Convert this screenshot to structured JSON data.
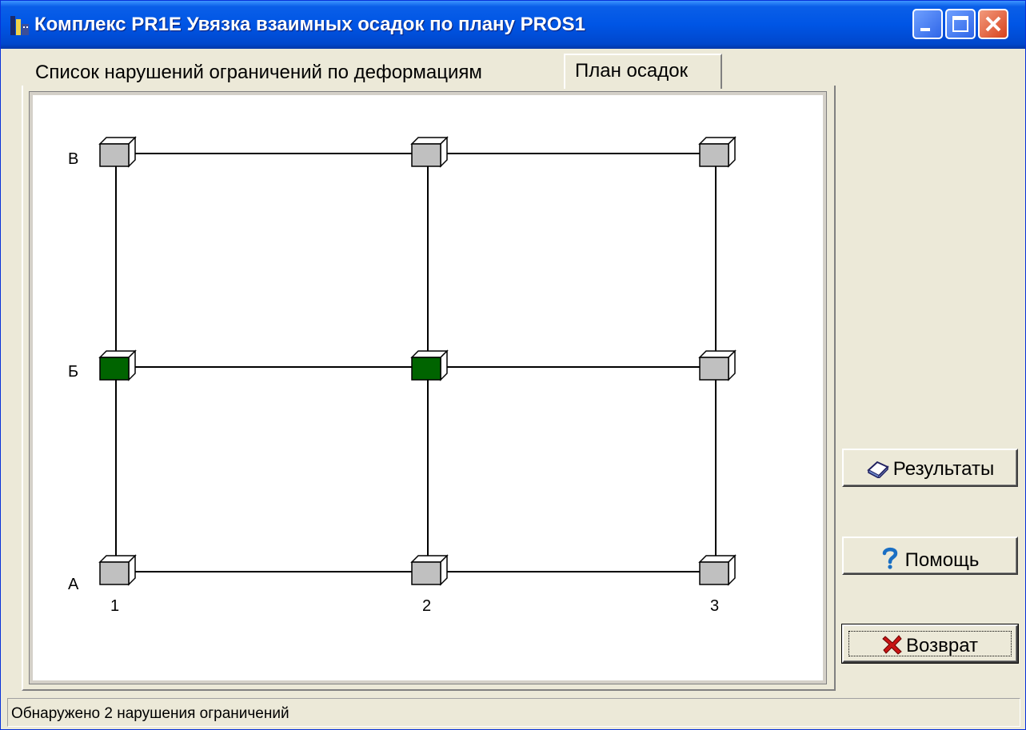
{
  "window": {
    "title": "Комплекс PR1E  Увязка взаимных осадок по плану PROS1"
  },
  "tabs": [
    {
      "label": "Список нарушений ограничений по деформациям",
      "active": false
    },
    {
      "label": "План осадок",
      "active": true
    }
  ],
  "plan": {
    "row_labels": [
      "В",
      "Б",
      "А"
    ],
    "column_labels": [
      "1",
      "2",
      "3"
    ],
    "nodes": [
      {
        "row": "В",
        "col": "1",
        "status": "normal"
      },
      {
        "row": "В",
        "col": "2",
        "status": "normal"
      },
      {
        "row": "В",
        "col": "3",
        "status": "normal"
      },
      {
        "row": "Б",
        "col": "1",
        "status": "violation"
      },
      {
        "row": "Б",
        "col": "2",
        "status": "violation"
      },
      {
        "row": "Б",
        "col": "3",
        "status": "normal"
      },
      {
        "row": "А",
        "col": "1",
        "status": "normal"
      },
      {
        "row": "А",
        "col": "2",
        "status": "normal"
      },
      {
        "row": "А",
        "col": "3",
        "status": "normal"
      }
    ],
    "colors": {
      "normal": "#c0c0c0",
      "violation": "#006400",
      "line": "#000000"
    }
  },
  "buttons": {
    "results": {
      "label": "Результаты",
      "icon": "book-icon"
    },
    "help": {
      "label": "Помощь",
      "icon": "question-mark-icon"
    },
    "return": {
      "label": "Возврат",
      "icon": "red-x-icon"
    }
  },
  "status": {
    "text": "Обнаружено 2 нарушения ограничений"
  }
}
